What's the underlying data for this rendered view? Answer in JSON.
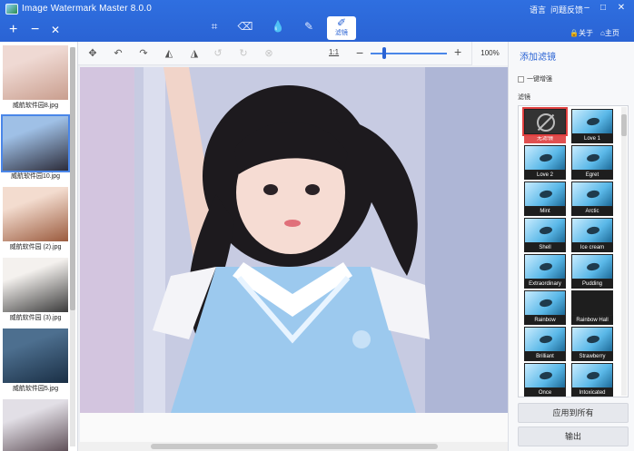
{
  "window": {
    "title": "Image Watermark Master 8.0.0",
    "lang": "语言",
    "feedback": "问题反馈"
  },
  "top_tools": {
    "filter_label": "滤镜"
  },
  "account": {
    "about": "关于",
    "home": "主页"
  },
  "thumbnails": [
    {
      "name": "威航软件园8.jpg",
      "colors": [
        "#efd9d3",
        "#c99e8e"
      ]
    },
    {
      "name": "威航软件园10.jpg",
      "colors": [
        "#9fc0e6",
        "#2c2c3a"
      ]
    },
    {
      "name": "威航软件园 (2).jpg",
      "colors": [
        "#f3dccf",
        "#9b5b3e"
      ]
    },
    {
      "name": "威航软件园 (3).jpg",
      "colors": [
        "#f4f1ee",
        "#3b3b3b"
      ]
    },
    {
      "name": "威航软件园5.jpg",
      "colors": [
        "#4d6f8f",
        "#1a2f45"
      ]
    },
    {
      "name": "",
      "colors": [
        "#e2dfe6",
        "#5a4a52"
      ]
    }
  ],
  "toolbar": {
    "ratio": "1:1",
    "zoom": "100%",
    "zoom_level": 0.15
  },
  "panel": {
    "title": "添加滤镜",
    "one_click": "一键增强",
    "filter_section": "滤镜",
    "apply_all": "应用到所有",
    "export": "输出",
    "filters": [
      "无滤镜",
      "Love 1",
      "Love 2",
      "Egret",
      "Mint",
      "Arctic",
      "Shell",
      "Ice cream",
      "Extraordinary",
      "Pudding",
      "Rainbow",
      "Rainbow Hall",
      "Brilliant",
      "Strawberry",
      "Once",
      "Intoxicated"
    ]
  }
}
